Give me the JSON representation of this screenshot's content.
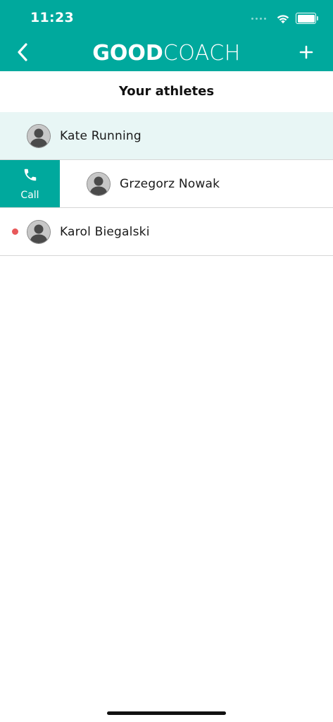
{
  "status_bar": {
    "time": "11:23"
  },
  "header": {
    "logo_bold": "GOOD",
    "logo_light": "COACH",
    "back_icon": "chevron-left-icon",
    "add_icon": "plus-icon"
  },
  "page": {
    "title": "Your athletes"
  },
  "athletes": [
    {
      "name": "Kate Running",
      "highlighted": true,
      "unread": false
    },
    {
      "name": "Grzegorz Nowak",
      "swiped": true,
      "action_label": "Call",
      "action_icon": "phone-icon"
    },
    {
      "name": "Karol Biegalski",
      "highlighted": false,
      "unread": true
    }
  ],
  "colors": {
    "brand": "#00a99d",
    "highlight_row": "#e8f6f5",
    "unread_dot": "#e8585a"
  }
}
